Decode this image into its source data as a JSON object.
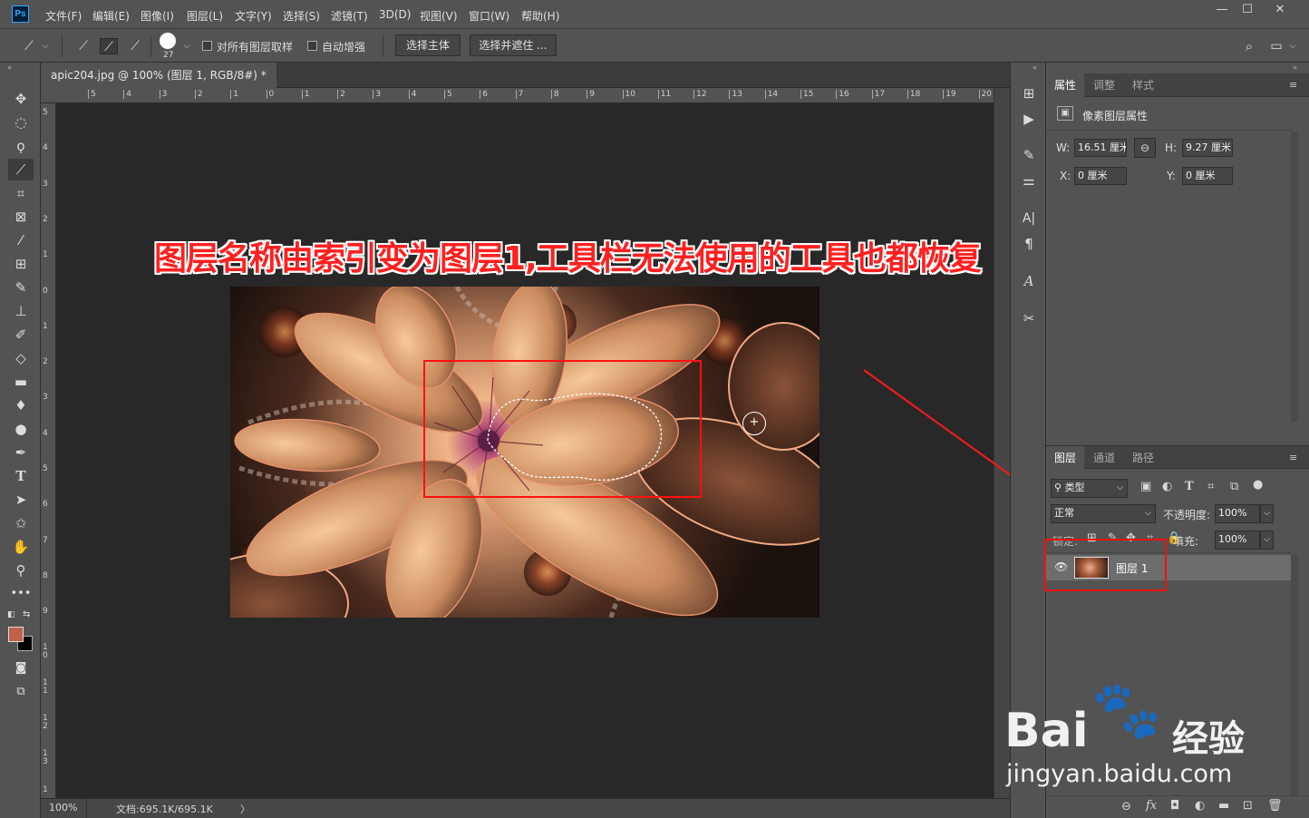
{
  "menubar": {
    "logo": "Ps",
    "items": [
      "文件(F)",
      "编辑(E)",
      "图像(I)",
      "图层(L)",
      "文字(Y)",
      "选择(S)",
      "滤镜(T)",
      "3D(D)",
      "视图(V)",
      "窗口(W)",
      "帮助(H)"
    ],
    "window_controls": [
      "—",
      "☐",
      "✕"
    ]
  },
  "options": {
    "brush_size": "27",
    "sample_all_layers": "对所有图层取样",
    "auto_enhance": "自动增强",
    "select_subject": "选择主体",
    "select_and_mask": "选择并遮住 ..."
  },
  "document": {
    "tab_title": "apic204.jpg @ 100% (图层 1, RGB/8#) *",
    "ruler_h": [
      "5",
      "4",
      "3",
      "2",
      "1",
      "0",
      "1",
      "2",
      "3",
      "4",
      "5",
      "6",
      "7",
      "8",
      "9",
      "10",
      "11",
      "12",
      "13",
      "14",
      "15",
      "16",
      "17",
      "18",
      "19",
      "20",
      "21"
    ],
    "ruler_v": [
      "5",
      "4",
      "3",
      "2",
      "1",
      "0",
      "1",
      "2",
      "3",
      "4",
      "5",
      "6",
      "7",
      "8",
      "9",
      "1\n0",
      "1\n1",
      "1\n2",
      "1\n3",
      "1"
    ],
    "zoom": "100%",
    "doc_size": "文档:695.1K/695.1K",
    "status_arrow": "〉"
  },
  "annotation": {
    "headline": "图层名称由索引变为图层1,工具栏无法使用的工具也都恢复"
  },
  "properties": {
    "tabs": [
      "属性",
      "调整",
      "样式"
    ],
    "header": "像素图层属性",
    "w_label": "W:",
    "w_value": "16.51 厘米",
    "h_label": "H:",
    "h_value": "9.27 厘米",
    "x_label": "X:",
    "x_value": "0 厘米",
    "y_label": "Y:",
    "y_value": "0 厘米"
  },
  "layers": {
    "tabs": [
      "图层",
      "通道",
      "路径"
    ],
    "filter_kind": "类型",
    "blend_mode": "正常",
    "opacity_label": "不透明度:",
    "opacity_value": "100%",
    "lock_label": "锁定:",
    "fill_label": "填充:",
    "fill_value": "100%",
    "layer_name": "图层 1",
    "footer_icons": [
      "link-icon",
      "fx-icon",
      "mask-icon",
      "adjustment-icon",
      "folder-icon",
      "new-layer-icon",
      "trash-icon"
    ]
  },
  "watermark": {
    "brand": "Bai",
    "brand_suffix": "经验",
    "url": "jingyan.baidu.com"
  },
  "colors": {
    "foreground": "#c0614c",
    "background": "#000000",
    "annotation_red": "#ff1010"
  }
}
